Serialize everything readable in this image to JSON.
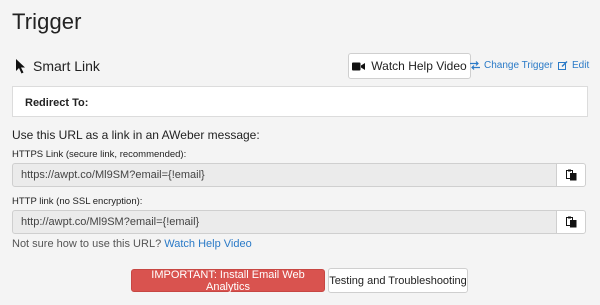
{
  "page": {
    "title": "Trigger"
  },
  "trigger": {
    "name": "Smart Link",
    "watch_help_video_label": "Watch Help Video",
    "change_trigger_label": "Change Trigger",
    "edit_label": "Edit"
  },
  "redirect": {
    "label": "Redirect To:"
  },
  "url_section": {
    "instruction": "Use this URL as a link in an AWeber message:",
    "https": {
      "label": "HTTPS Link (secure link, recommended):",
      "value": "https://awpt.co/Ml9SM?email={!email}"
    },
    "http": {
      "label": "HTTP link (no SSL encryption):",
      "value": "http://awpt.co/Ml9SM?email={!email}"
    },
    "help_text": "Not sure how to use this URL?",
    "help_link": "Watch Help Video"
  },
  "buttons": {
    "important": "IMPORTANT: Install Email Web Analytics",
    "testing": "Testing and Troubleshooting"
  },
  "icons": {
    "cursor": "cursor-arrow-icon",
    "video": "video-camera-icon",
    "swap": "swap-arrows-icon",
    "pencil": "pencil-edit-icon",
    "clipboard": "clipboard-copy-icon"
  },
  "colors": {
    "link": "#2a7ac7",
    "danger": "#d9534f",
    "background": "#f4f4f4"
  }
}
